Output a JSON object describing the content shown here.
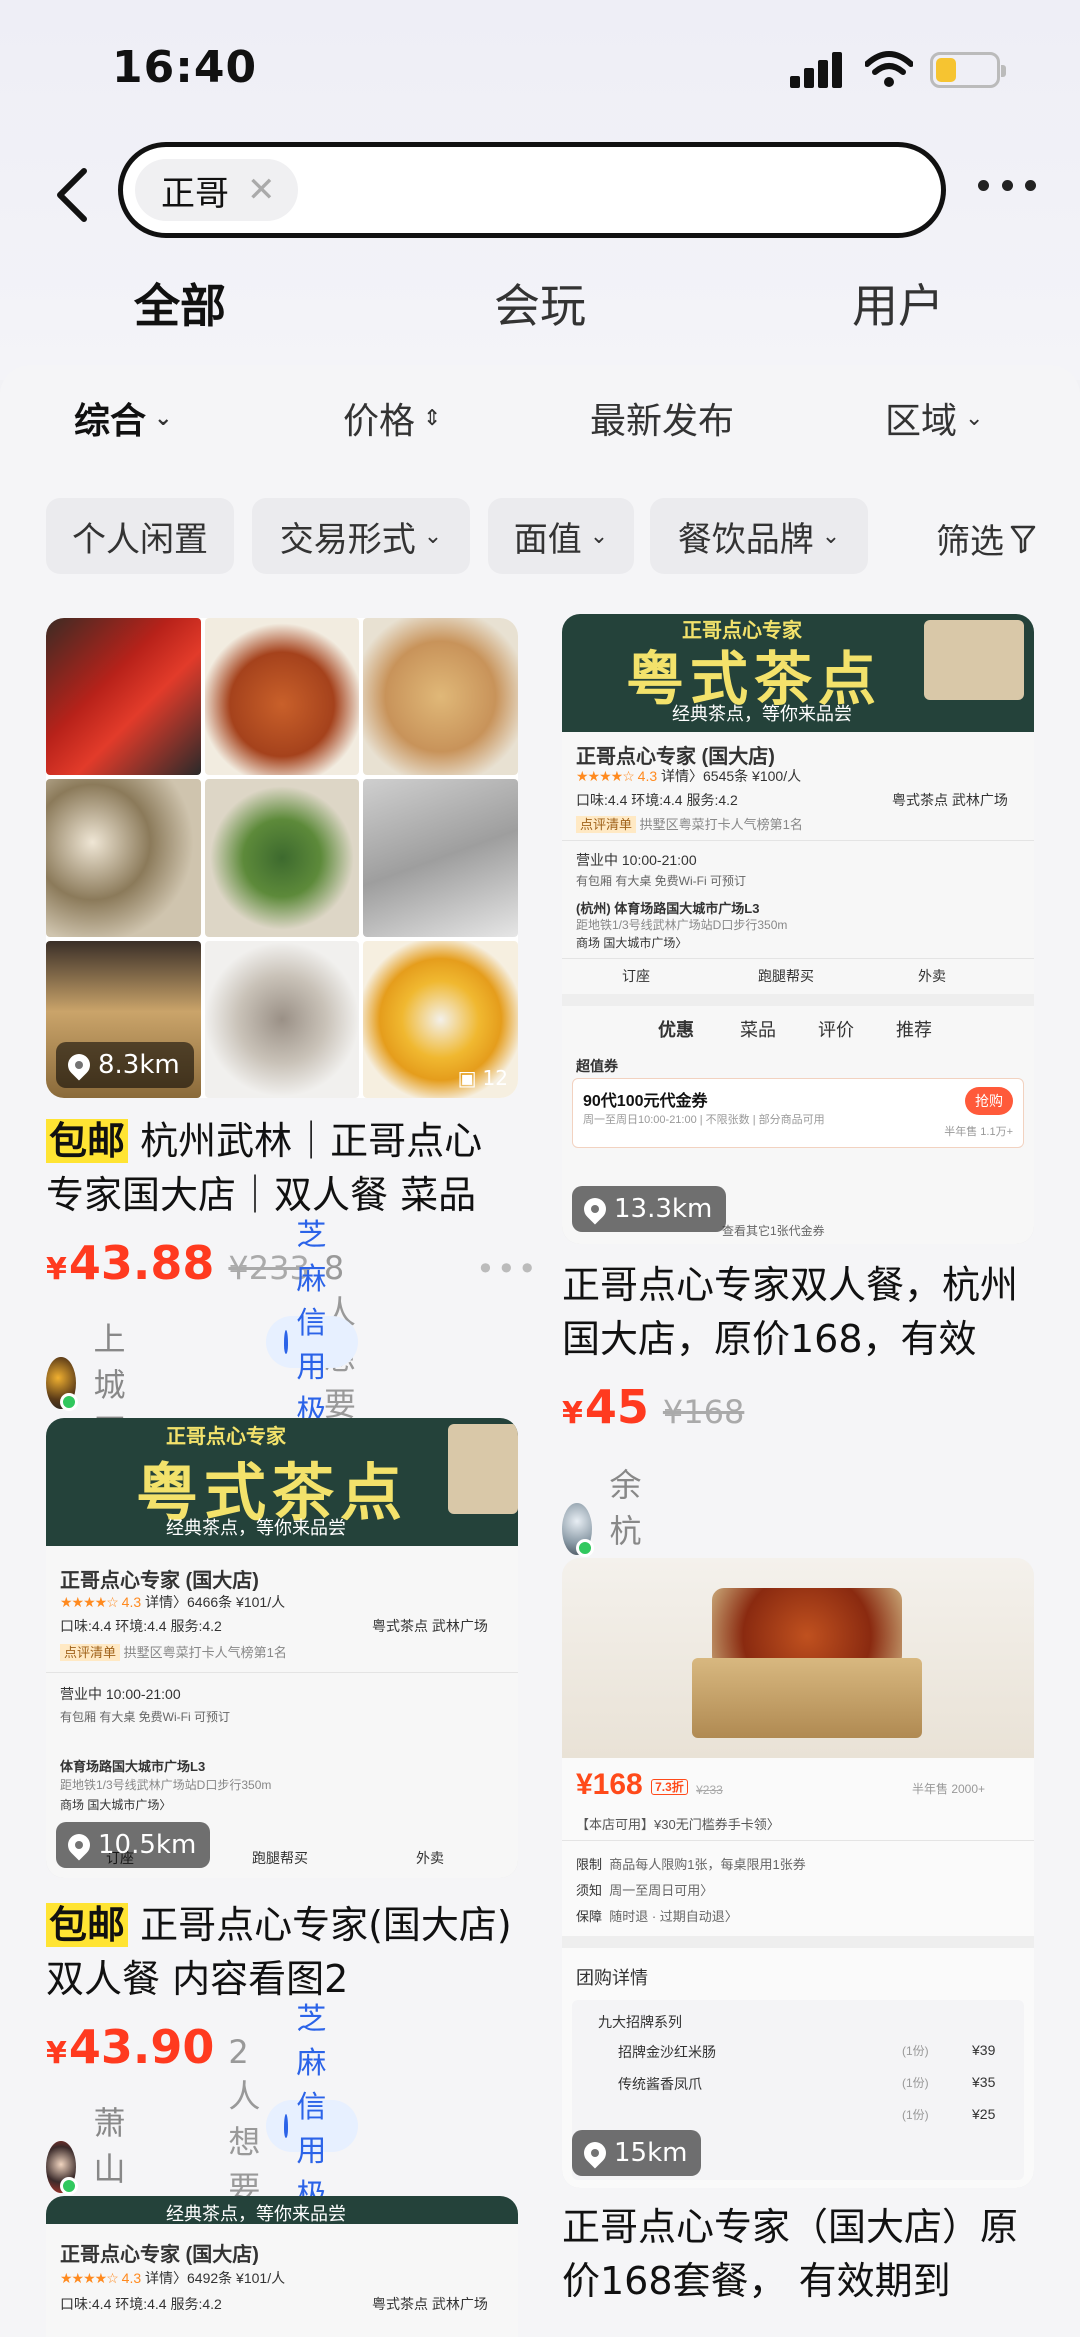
{
  "status_bar": {
    "time": "16:40"
  },
  "search": {
    "query": "正哥"
  },
  "tabs": [
    {
      "label": "全部",
      "active": true
    },
    {
      "label": "会玩",
      "active": false
    },
    {
      "label": "用户",
      "active": false
    }
  ],
  "sort": {
    "comprehensive": "综合",
    "price": "价格",
    "latest": "最新发布",
    "region": "区域"
  },
  "filters": {
    "personal": "个人闲置",
    "trade_form": "交易形式",
    "face_value": "面值",
    "brand": "餐饮品牌",
    "screen": "筛选"
  },
  "colors": {
    "accent_yellow": "#ffe433",
    "price_red": "#ff3a1f",
    "credit_blue": "#2b63e8"
  },
  "cards": [
    {
      "distance": "8.3km",
      "photo_count": "12",
      "tag": "包邮",
      "title": "杭州武林｜正哥点心专家国大店｜双人餐 菜品",
      "currency": "¥",
      "price": "43.88",
      "original": "¥233",
      "want": "8人想要",
      "region": "上城区",
      "credit": "芝麻信用极好"
    },
    {
      "distance": "13.3km",
      "title": "正哥点心专家双人餐，杭州国大店，原价168，有效",
      "currency": "¥",
      "price": "45",
      "original": "¥168",
      "region": "余杭区",
      "shop": {
        "banner_top": "正哥点心专家",
        "banner_big": "粤式茶点",
        "banner_sub": "经典茶点，等你来品尝",
        "name": "正哥点心专家 (国大店)",
        "rating": "4.3",
        "reviews": "详情〉6545条 ¥100/人",
        "scores": "口味:4.4 环境:4.4 服务:4.2",
        "cuisine": "粤式茶点 武林广场",
        "rank": "拱墅区粤菜打卡人气榜第1名",
        "rank_label": "点评清单",
        "hours": "营业中 10:00-21:00",
        "amenities": "有包厢 有大桌 免费Wi-Fi 可预订",
        "address": "(杭州) 体育场路国大城市广场L3",
        "metro": "距地铁1/3号线武林广场站D口步行350m",
        "mall": "商场 国大城市广场〉",
        "actions": [
          "订座",
          "跑腿帮买",
          "外卖"
        ],
        "tabs": [
          "优惠",
          "菜品",
          "评价",
          "推荐"
        ],
        "voucher_label": "超值券",
        "voucher": "90代100元代金券",
        "voucher_sub": "周一至周日10:00-21:00 | 不限张数 | 部分商品可用",
        "grab": "抢购",
        "sold": "半年售 1.1万+",
        "more": "查看其它1张代金券"
      }
    },
    {
      "distance": "10.5km",
      "tag": "包邮",
      "title": "正哥点心专家(国大店) 双人餐 内容看图2",
      "currency": "¥",
      "price": "43.90",
      "want": "2人想要",
      "region": "萧山区",
      "credit": "芝麻信用极好",
      "shop": {
        "banner_top": "正哥点心专家",
        "banner_big": "粤式茶点",
        "banner_sub": "经典茶点，等你来品尝",
        "name": "正哥点心专家 (国大店)",
        "rating": "4.3",
        "reviews": "详情〉6466条 ¥101/人",
        "scores": "口味:4.4 环境:4.4 服务:4.2",
        "cuisine": "粤式茶点 武林广场",
        "rank": "拱墅区粤菜打卡人气榜第1名",
        "rank_label": "点评清单",
        "hours": "营业中 10:00-21:00",
        "amenities": "有包厢 有大桌 免费Wi-Fi 可预订",
        "address": "体育场路国大城市广场L3",
        "metro": "距地铁1/3号线武林广场站D口步行350m",
        "mall": "商场 国大城市广场〉",
        "actions": [
          "订座",
          "跑腿帮买",
          "外卖"
        ]
      }
    },
    {
      "distance": "15km",
      "title": "正哥点心专家（国大店）原价168套餐， 有效期到",
      "deal": {
        "price": "¥168",
        "discount": "7.3折",
        "orig": "¥233",
        "sold": "半年售 2000+",
        "note": "【本店可用】¥30无门槛券手卡领〉",
        "limit_label": "限制",
        "limit": "商品每人限购1张，每桌限用1张券",
        "notice_label": "须知",
        "notice": "周一至周日可用〉",
        "guarantee_label": "保障",
        "guarantee": "随时退 · 过期自动退〉",
        "section": "团购详情",
        "group": "九大招牌系列",
        "items": [
          {
            "name": "招牌金沙红米肠",
            "qty": "(1份)",
            "price": "¥39"
          },
          {
            "name": "传统酱香凤爪",
            "qty": "(1份)",
            "price": "¥35"
          },
          {
            "name": "",
            "qty": "(1份)",
            "price": "¥25"
          }
        ]
      }
    },
    {
      "shop": {
        "banner_sub": "经典茶点，等你来品尝",
        "name": "正哥点心专家 (国大店)",
        "rating": "4.3",
        "reviews": "详情〉6492条 ¥101/人",
        "scores": "口味:4.4 环境:4.4 服务:4.2",
        "cuisine": "粤式茶点 武林广场"
      }
    }
  ]
}
